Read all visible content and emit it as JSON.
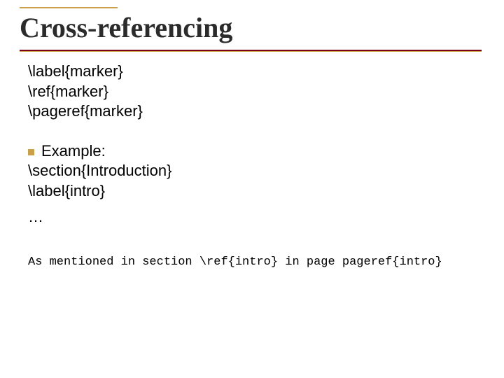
{
  "title": "Cross-referencing",
  "cmds": {
    "label": "\\label{marker}",
    "ref": "\\ref{marker}",
    "pageref": "\\pageref{marker}"
  },
  "example": {
    "label": "Example:",
    "section": "\\section{Introduction}",
    "labelintro": "\\label{intro}",
    "ellipsis": "…"
  },
  "mono": {
    "pre": "As mentioned in section ",
    "ref": "\\ref{intro}",
    "mid": " in page ",
    "pageref": "pageref{intro}"
  }
}
